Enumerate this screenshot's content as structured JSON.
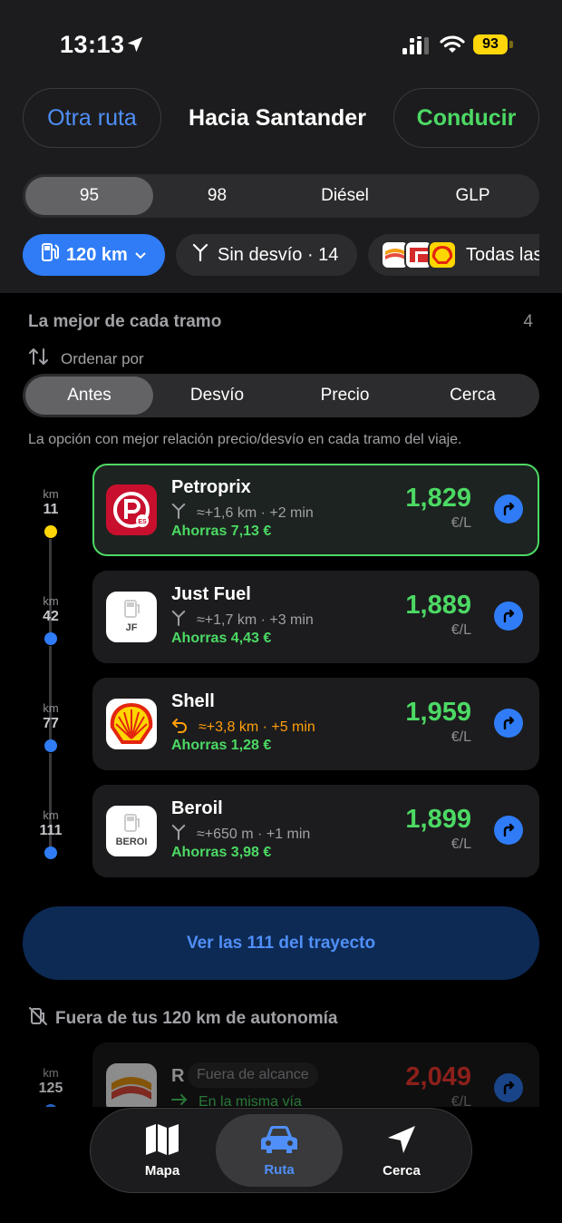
{
  "status_bar": {
    "time": "13:13",
    "battery": "93"
  },
  "header": {
    "other_route": "Otra ruta",
    "title": "Hacia Santander",
    "drive": "Conducir"
  },
  "fuel_types": [
    {
      "label": "95",
      "active": true
    },
    {
      "label": "98",
      "active": false
    },
    {
      "label": "Diésel",
      "active": false
    },
    {
      "label": "GLP",
      "active": false
    }
  ],
  "filters": {
    "range": "120 km",
    "detour": "Sin desvío · 14",
    "brands": "Todas las"
  },
  "section": {
    "title": "La mejor de cada tramo",
    "count": "4",
    "sort_label": "Ordenar por",
    "sort_options": [
      "Antes",
      "Desvío",
      "Precio",
      "Cerca"
    ],
    "description": "La opción con mejor relación precio/desvío en cada tramo del viaje."
  },
  "stations": [
    {
      "km_label": "km",
      "km": "11",
      "name": "Petroprix",
      "detour": "≈+1,6 km · +2 min",
      "savings": "Ahorras 7,13 €",
      "price": "1,829",
      "unit": "€/L",
      "dot_color": "#ffd60a"
    },
    {
      "km_label": "km",
      "km": "42",
      "name": "Just Fuel",
      "detour": "≈+1,7 km · +3 min",
      "savings": "Ahorras 4,43 €",
      "price": "1,889",
      "unit": "€/L",
      "dot_color": "#2f7cf6",
      "logo_text": "JF"
    },
    {
      "km_label": "km",
      "km": "77",
      "name": "Shell",
      "detour": "≈+3,8 km · +5 min",
      "savings": "Ahorras 1,28 €",
      "price": "1,959",
      "unit": "€/L",
      "dot_color": "#2f7cf6"
    },
    {
      "km_label": "km",
      "km": "111",
      "name": "Beroil",
      "detour": "≈+650 m · +1 min",
      "savings": "Ahorras 3,98 €",
      "price": "1,899",
      "unit": "€/L",
      "dot_color": "#2f7cf6",
      "logo_text": "BEROI"
    }
  ],
  "view_all": "Ver las 111 del trayecto",
  "out_of_range": {
    "title": "Fuera de tus 120 km de autonomía",
    "km_label": "km",
    "km": "125",
    "name": "R",
    "badge": "Fuera de alcance",
    "note": "En la misma vía",
    "price": "2,049",
    "unit": "€/L"
  },
  "tabs": {
    "map": "Mapa",
    "route": "Ruta",
    "nearby": "Cerca"
  },
  "colors": {
    "accent": "#2f7cf6",
    "green": "#4cd964",
    "warning": "#ff9f0a",
    "red": "#ff3b30"
  }
}
